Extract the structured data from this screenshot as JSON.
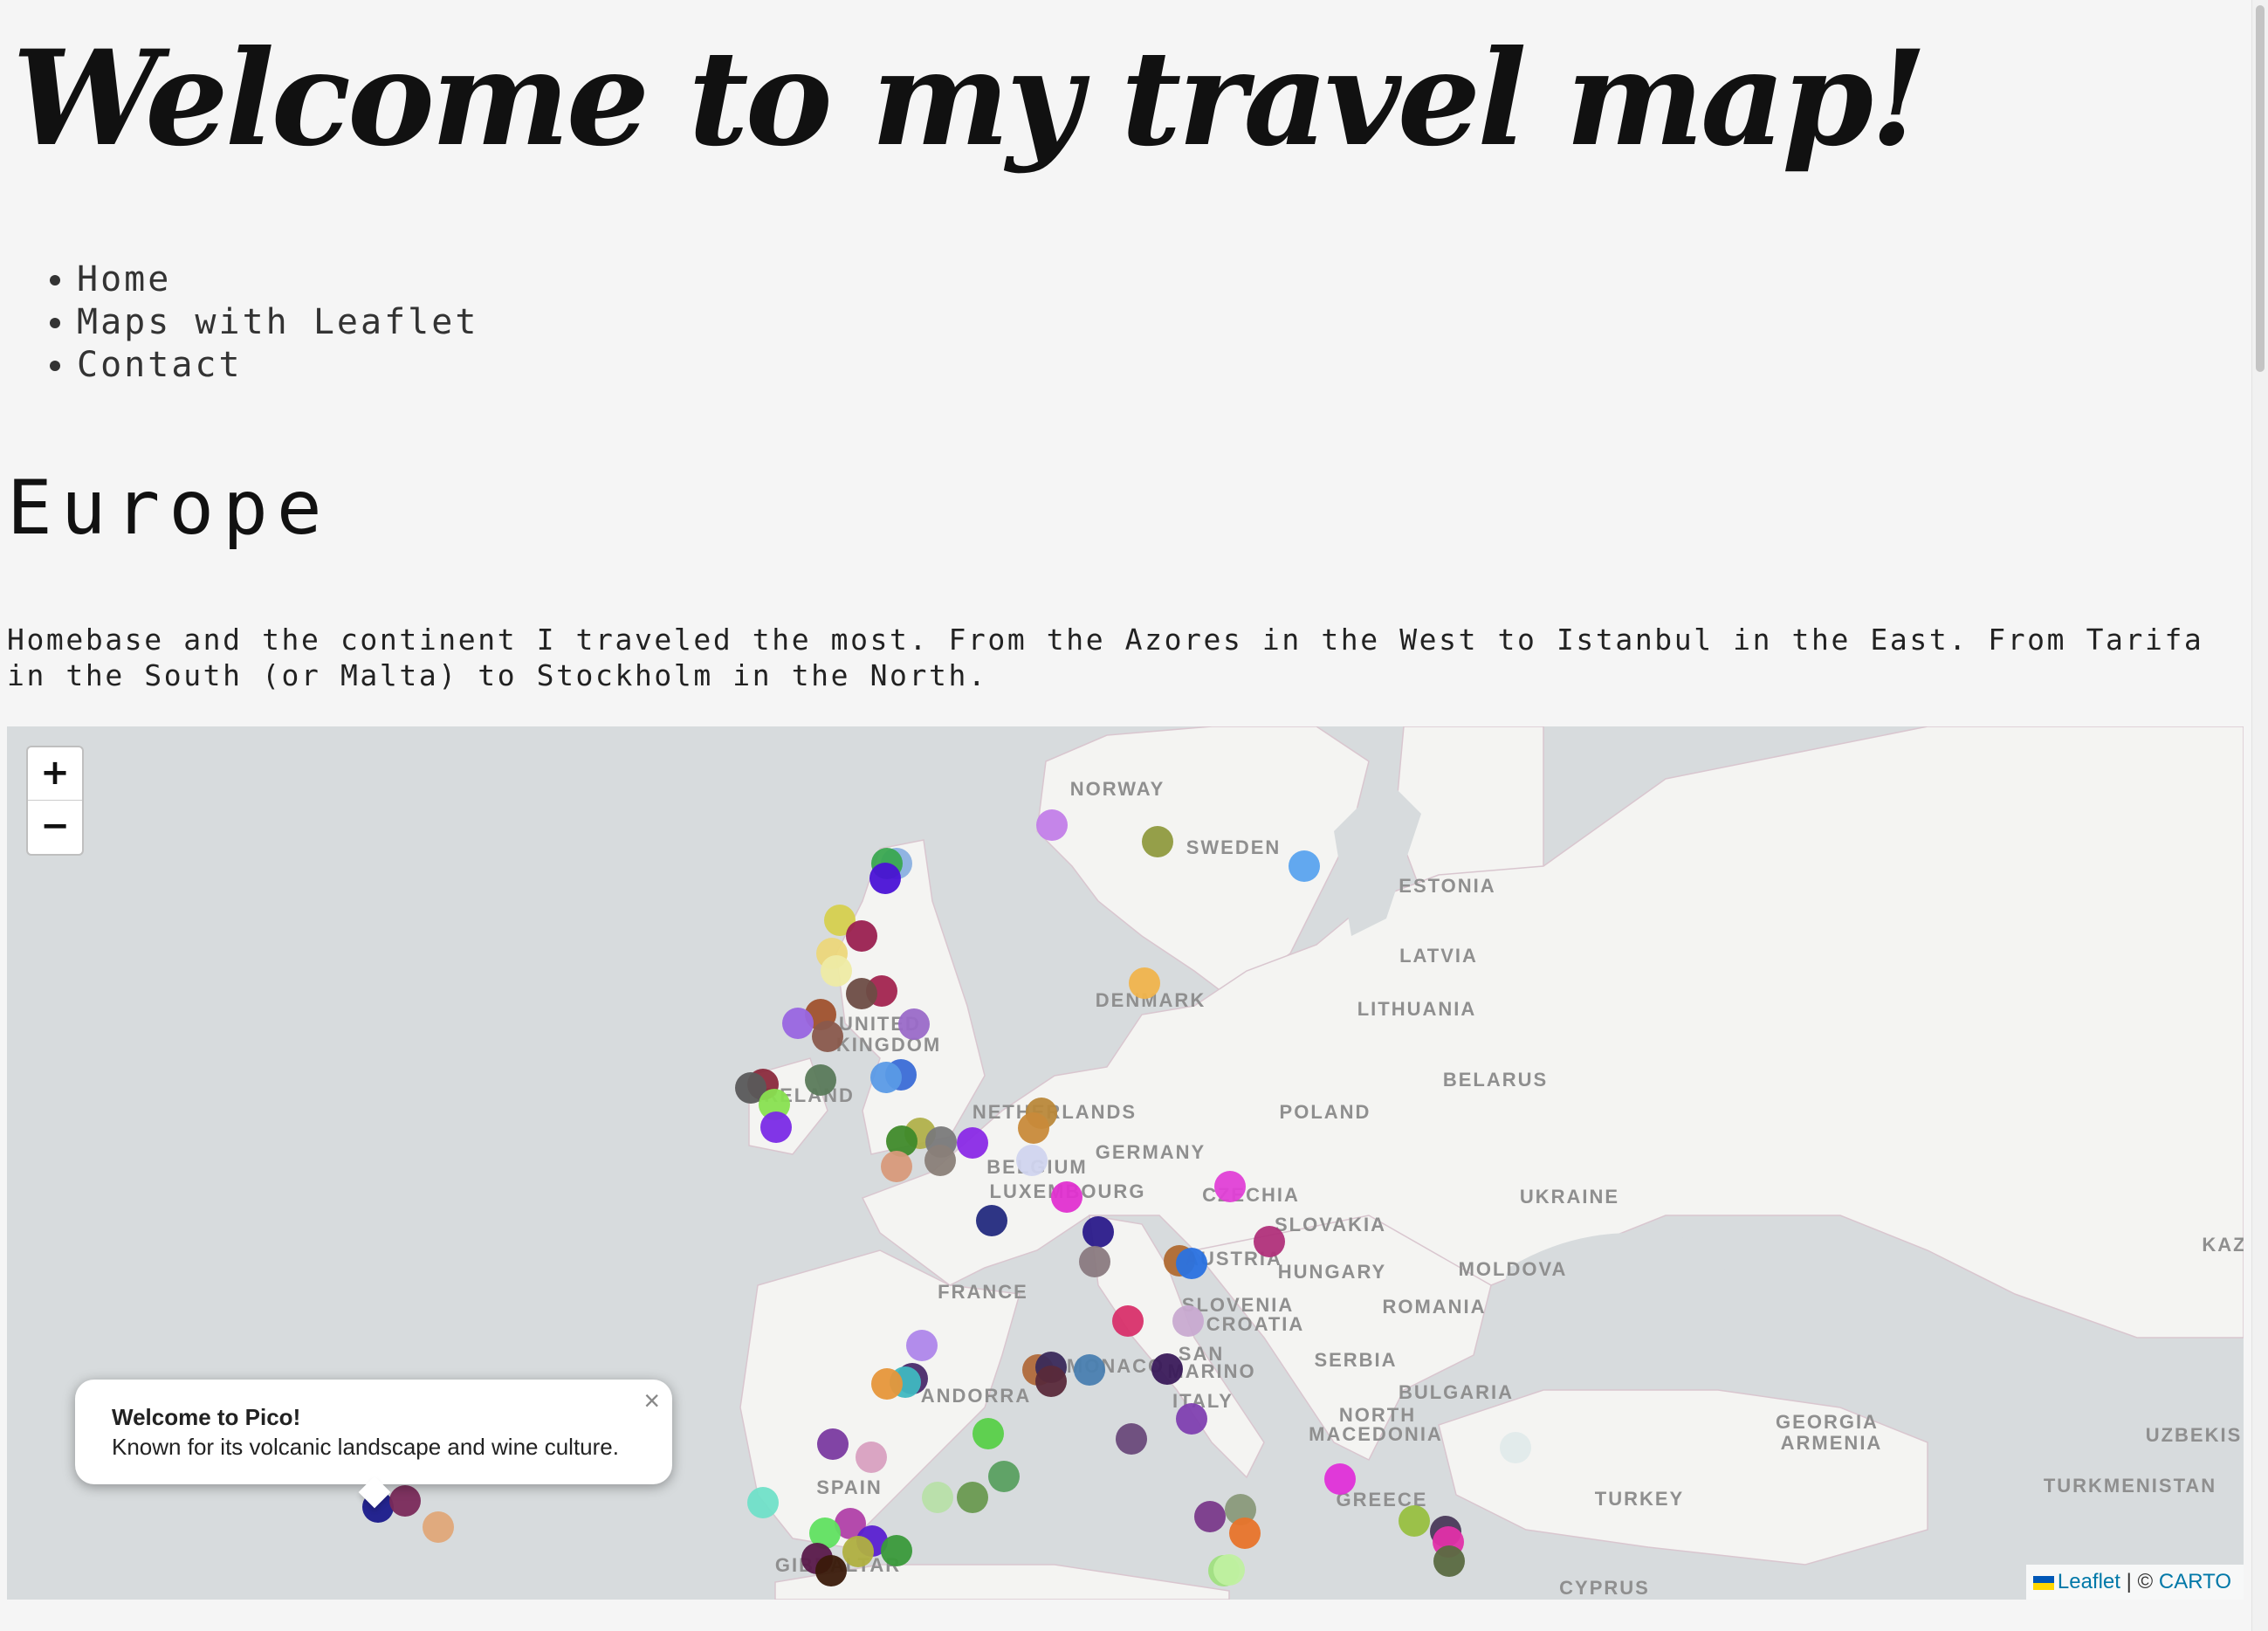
{
  "site_title": "Welcome to my travel map!",
  "nav": [
    "Home",
    "Maps with Leaflet",
    "Contact"
  ],
  "section": {
    "title": "Europe",
    "intro": "Homebase and the continent I traveled the most. From the Azores in the West to Istanbul in the East. From Tarifa in the South (or Malta) to Stockholm in the North."
  },
  "map": {
    "zoom_in": "+",
    "zoom_out": "−",
    "country_labels": [
      "NORWAY",
      "SWEDEN",
      "ESTONIA",
      "LATVIA",
      "LITHUANIA",
      "DENMARK",
      "UNITED",
      "KINGDOM",
      "NETHERLANDS",
      "BELGIUM",
      "LUXEMBOURG",
      "GERMANY",
      "POLAND",
      "BELARUS",
      "UKRAINE",
      "CZECHIA",
      "SLOVAKIA",
      "AUSTRIA",
      "HUNGARY",
      "MOLDOVA",
      "ROMANIA",
      "FRANCE",
      "SLOVENIA",
      "CROATIA",
      "SERBIA",
      "SAN",
      "MARINO",
      "ITALY",
      "BULGARIA",
      "NORTH",
      "MACEDONIA",
      "ANDORRA",
      "SPAIN",
      "GIBRALTAR",
      "GREECE",
      "TURKEY",
      "GEORGIA",
      "ARMENIA",
      "UZBEKIS",
      "TURKMENISTAN",
      "KAZ",
      "CYPRUS",
      "IRELAND",
      "MONACO"
    ],
    "popup": {
      "title": "Welcome to Pico!",
      "text": "Known for its volcanic landscape and wine culture.",
      "close": "×"
    },
    "attribution": {
      "leaflet": "Leaflet",
      "separator": " | © ",
      "carto": "CARTO"
    }
  },
  "colors": {
    "background": "#f5f5f5",
    "sea": "#d7dbdd",
    "land": "#f4f4f2",
    "link": "#0078a8"
  }
}
